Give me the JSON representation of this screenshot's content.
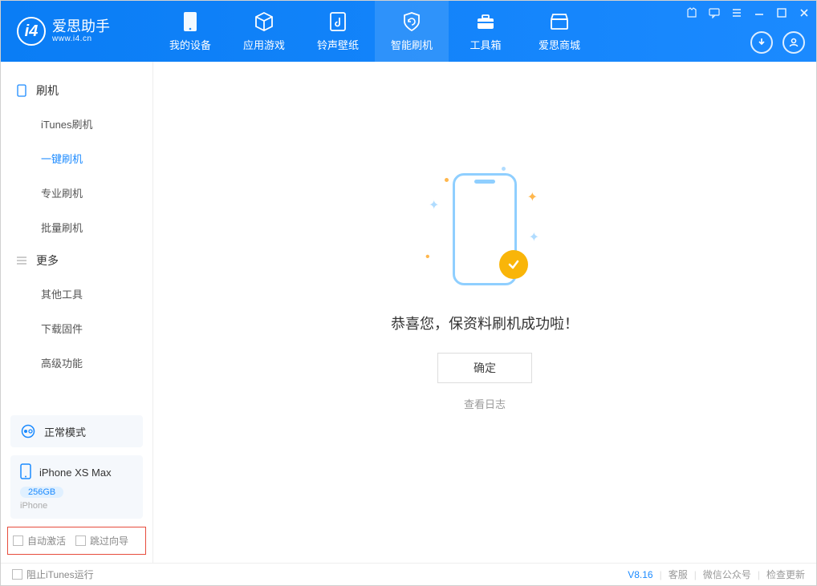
{
  "app": {
    "title": "爱思助手",
    "subtitle": "www.i4.cn"
  },
  "tabs": {
    "device": "我的设备",
    "apps": "应用游戏",
    "ringtone": "铃声壁纸",
    "flash": "智能刷机",
    "toolbox": "工具箱",
    "store": "爱思商城"
  },
  "sidebar": {
    "section1": "刷机",
    "items1": {
      "itunes": "iTunes刷机",
      "oneclick": "一键刷机",
      "pro": "专业刷机",
      "batch": "批量刷机"
    },
    "section2": "更多",
    "items2": {
      "other": "其他工具",
      "download": "下载固件",
      "advanced": "高级功能"
    },
    "mode": "正常模式",
    "device": {
      "name": "iPhone XS Max",
      "storage": "256GB",
      "type": "iPhone"
    },
    "options": {
      "auto_activate": "自动激活",
      "skip_guide": "跳过向导"
    }
  },
  "main": {
    "success_text": "恭喜您，保资料刷机成功啦！",
    "ok_button": "确定",
    "view_log": "查看日志"
  },
  "footer": {
    "block_itunes": "阻止iTunes运行",
    "version": "V8.16",
    "service": "客服",
    "wechat": "微信公众号",
    "update": "检查更新"
  }
}
